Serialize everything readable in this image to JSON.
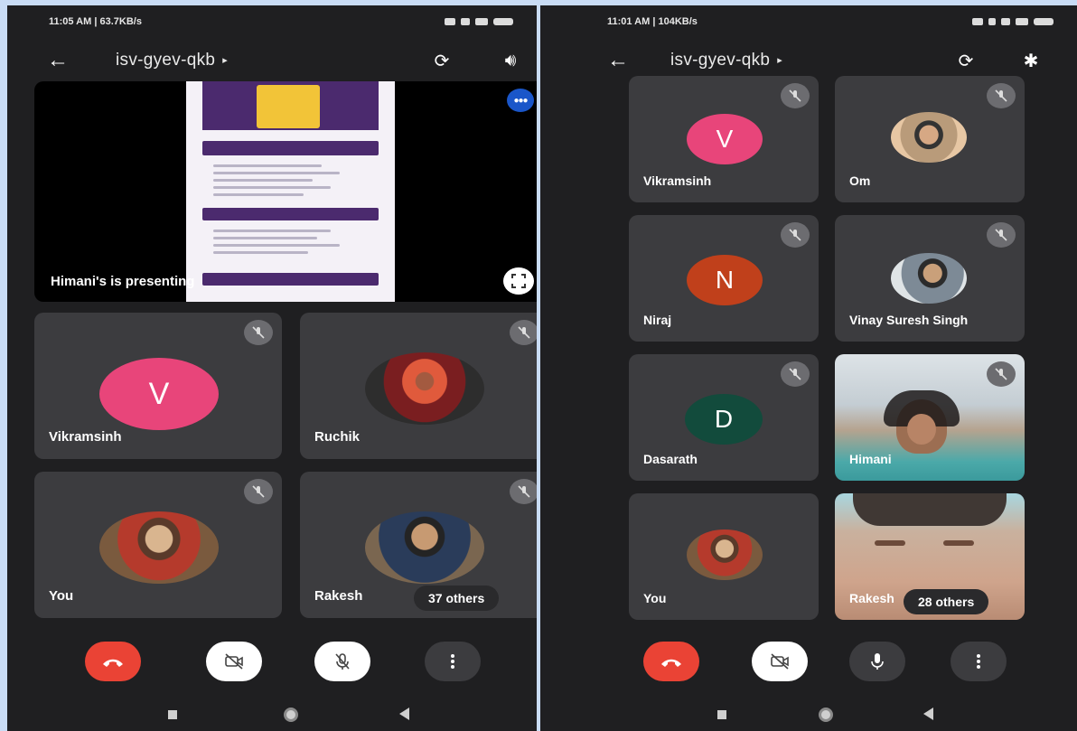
{
  "left": {
    "status": {
      "time": "11:05 AM | 63.7KB/s",
      "notif_icon": "notification-icon"
    },
    "header": {
      "meeting_code": "isv-gyev-qkb",
      "caret": "▸",
      "icons": [
        "back-arrow-icon",
        "switch-camera-icon",
        "speaker-icon"
      ]
    },
    "presentation": {
      "label": "Himani's is presenting"
    },
    "tiles": [
      {
        "name": "Vikramsinh",
        "avatar_letter": "V",
        "avatar_color": "#e8457a",
        "muted": true
      },
      {
        "name": "Ruchik",
        "photo": true,
        "muted": true
      },
      {
        "name": "You",
        "photo": true,
        "muted": true
      },
      {
        "name": "Rakesh",
        "photo": true,
        "muted": true
      }
    ],
    "others": "37 others",
    "controls": {
      "end_call_color": "#ea4335",
      "camera": "camera-off",
      "mic": "mic-off",
      "more": "more-options"
    }
  },
  "right": {
    "status": {
      "time": "11:01 AM | 104KB/s",
      "notif_icon": "notification-icon"
    },
    "header": {
      "meeting_code": "isv-gyev-qkb",
      "caret": "▸",
      "icons": [
        "back-arrow-icon",
        "switch-camera-icon",
        "bluetooth-icon"
      ]
    },
    "tiles": [
      {
        "name": "Vikramsinh",
        "avatar_letter": "V",
        "avatar_color": "#e8457a",
        "muted": true
      },
      {
        "name": "Om",
        "photo": true,
        "muted": true
      },
      {
        "name": "Niraj",
        "avatar_letter": "N",
        "avatar_color": "#c0401b",
        "muted": true
      },
      {
        "name": "Vinay Suresh Singh",
        "photo": true,
        "muted": true
      },
      {
        "name": "Dasarath",
        "avatar_letter": "D",
        "avatar_color": "#124b3c",
        "muted": true
      },
      {
        "name": "Himani",
        "video": true,
        "muted": true
      },
      {
        "name": "You",
        "photo": true,
        "muted": false
      },
      {
        "name": "Rakesh",
        "video": true,
        "muted": false
      }
    ],
    "others": "28 others",
    "controls": {
      "end_call_color": "#ea4335",
      "camera": "camera-off",
      "mic": "mic-on",
      "more": "more-options"
    }
  }
}
